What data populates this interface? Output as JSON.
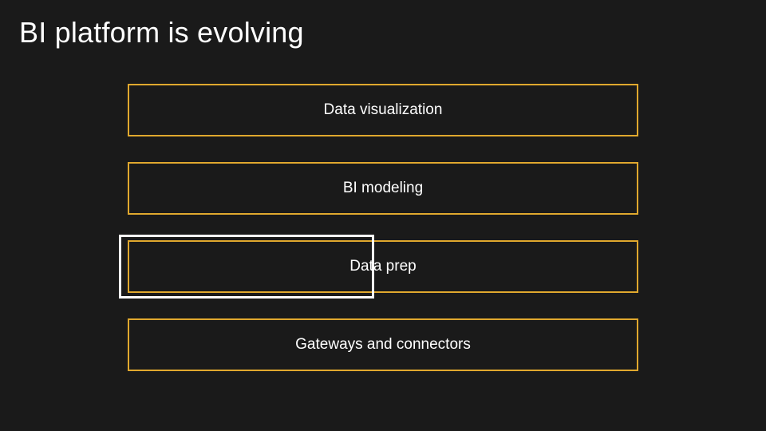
{
  "title": "BI platform is evolving",
  "layers": {
    "l0": "Data visualization",
    "l1": "BI modeling",
    "l2": "Data prep",
    "l3": "Gateways and connectors"
  },
  "colors": {
    "background": "#1a1a1a",
    "layerBorder": "#e0a82e",
    "highlight": "#ffffff",
    "text": "#ffffff"
  }
}
